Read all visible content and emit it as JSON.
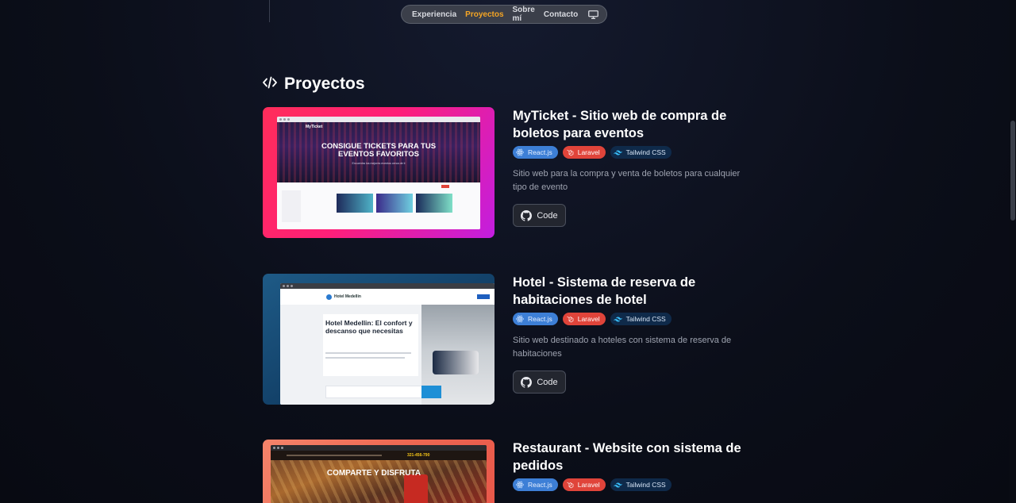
{
  "nav": {
    "items": [
      "Experiencia",
      "Proyectos",
      "Sobre mí",
      "Contacto"
    ],
    "active": "Proyectos",
    "theme_icon": "monitor-icon"
  },
  "section": {
    "icon": "code-icon",
    "title": "Proyectos"
  },
  "projects": [
    {
      "title": "MyTicket - Sitio web de compra de boletos para eventos",
      "tags": [
        "React.js",
        "Laravel",
        "Tailwind CSS"
      ],
      "description": "Sitio web para la compra y venta de boletos para cualquier tipo de evento",
      "code_label": "Code",
      "preview": {
        "brand": "MyTicket",
        "headline": "CONSIGUE TICKETS PARA TUS EVENTOS FAVORITOS",
        "subline": "Encuentra los mejores eventos cerca de ti"
      }
    },
    {
      "title": "Hotel - Sistema de reserva de habitaciones de hotel",
      "tags": [
        "React.js",
        "Laravel",
        "Tailwind CSS"
      ],
      "description": "Sitio web destinado a hoteles con sistema de reserva de habitaciones",
      "code_label": "Code",
      "preview": {
        "brand": "Hotel Medellin",
        "headline": "Hotel Medellin: El confort y descanso que necesitas"
      }
    },
    {
      "title": "Restaurant - Website con sistema de pedidos",
      "tags": [
        "React.js",
        "Laravel",
        "Tailwind CSS"
      ],
      "preview": {
        "headline": "COMPARTE Y DISFRUTA",
        "phone": "321-456-790"
      }
    }
  ],
  "colors": {
    "accent": "#f5a524",
    "react": "#3d7fd6",
    "laravel": "#e0443a",
    "tailwind": "#0f2a4a"
  }
}
